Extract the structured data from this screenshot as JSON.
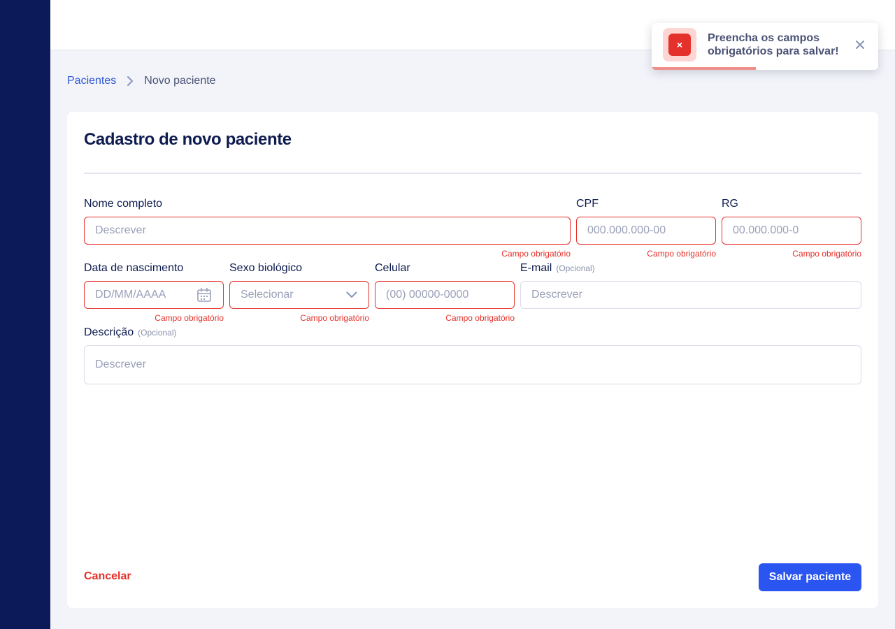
{
  "breadcrumb": {
    "parent": "Pacientes",
    "current": "Novo paciente"
  },
  "card": {
    "title": "Cadastro de novo paciente"
  },
  "form": {
    "nome": {
      "label": "Nome completo",
      "placeholder": "Descrever",
      "error": "Campo obrigatório"
    },
    "cpf": {
      "label": "CPF",
      "placeholder": "000.000.000-00",
      "error": "Campo obrigatório"
    },
    "rg": {
      "label": "RG",
      "placeholder": "00.000.000-0",
      "error": "Campo obrigatório"
    },
    "nascimento": {
      "label": "Data de nascimento",
      "placeholder": "DD/MM/AAAA",
      "error": "Campo obrigatório"
    },
    "sexo": {
      "label": "Sexo biológico",
      "placeholder": "Selecionar",
      "error": "Campo obrigatório"
    },
    "celular": {
      "label": "Celular",
      "placeholder": "(00) 00000-0000",
      "error": "Campo obrigatório"
    },
    "email": {
      "label": "E-mail",
      "optional": "(Opcional)",
      "placeholder": "Descrever"
    },
    "descricao": {
      "label": "Descrição",
      "optional": "(Opcional)",
      "placeholder": "Descrever"
    }
  },
  "actions": {
    "cancel": "Cancelar",
    "save": "Salvar paciente"
  },
  "toast": {
    "message": "Preencha os campos obrigatórios para salvar!",
    "icon": "×",
    "progress": 0.46
  },
  "icons": {
    "breadcrumb_sep": "chevron-right-icon",
    "date": "calendar-icon",
    "select": "chevron-down-icon",
    "toast_close": "close-icon",
    "toast_status": "error-icon"
  },
  "colors": {
    "sidebar": "#0d1a5a",
    "primary": "#2b55f0",
    "error": "#e5312b",
    "heading": "#0d1b4f"
  }
}
